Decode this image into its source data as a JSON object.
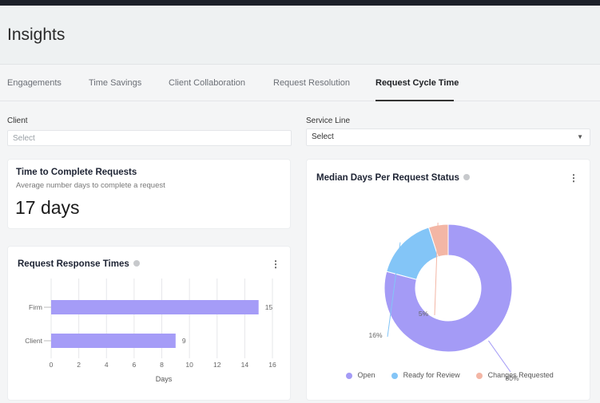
{
  "page": {
    "title": "Insights"
  },
  "tabs": [
    {
      "label": "Engagements"
    },
    {
      "label": "Time Savings"
    },
    {
      "label": "Client Collaboration"
    },
    {
      "label": "Request Resolution"
    },
    {
      "label": "Request Cycle Time",
      "active": true
    }
  ],
  "filters": {
    "client": {
      "label": "Client",
      "placeholder": "Select"
    },
    "service_line": {
      "label": "Service Line",
      "value": "Select"
    }
  },
  "complete_card": {
    "title": "Time to Complete Requests",
    "subtitle": "Average number days to complete a request",
    "value": "17 days"
  },
  "response_card": {
    "title": "Request Response Times"
  },
  "status_card": {
    "title": "Median Days Per Request Status"
  },
  "chart_data": [
    {
      "type": "bar",
      "orientation": "horizontal",
      "categories": [
        "Firm",
        "Client"
      ],
      "values": [
        15,
        9
      ],
      "data_labels": [
        "15",
        "9"
      ],
      "xlabel": "Days",
      "xlim": [
        0,
        16
      ],
      "xticks": [
        "0",
        "2",
        "4",
        "6",
        "8",
        "10",
        "12",
        "14",
        "16"
      ],
      "grid": "vertical",
      "color": "#a59cf7"
    },
    {
      "type": "pie",
      "style": "donut",
      "slices": [
        {
          "name": "Open",
          "value": 80,
          "label": "80%",
          "color": "#a49bf6"
        },
        {
          "name": "Ready for Review",
          "value": 16,
          "label": "16%",
          "color": "#83c5f7"
        },
        {
          "name": "Changes Requested",
          "value": 5,
          "label": "5%",
          "color": "#f3b6a5"
        }
      ],
      "legend_position": "bottom"
    }
  ]
}
